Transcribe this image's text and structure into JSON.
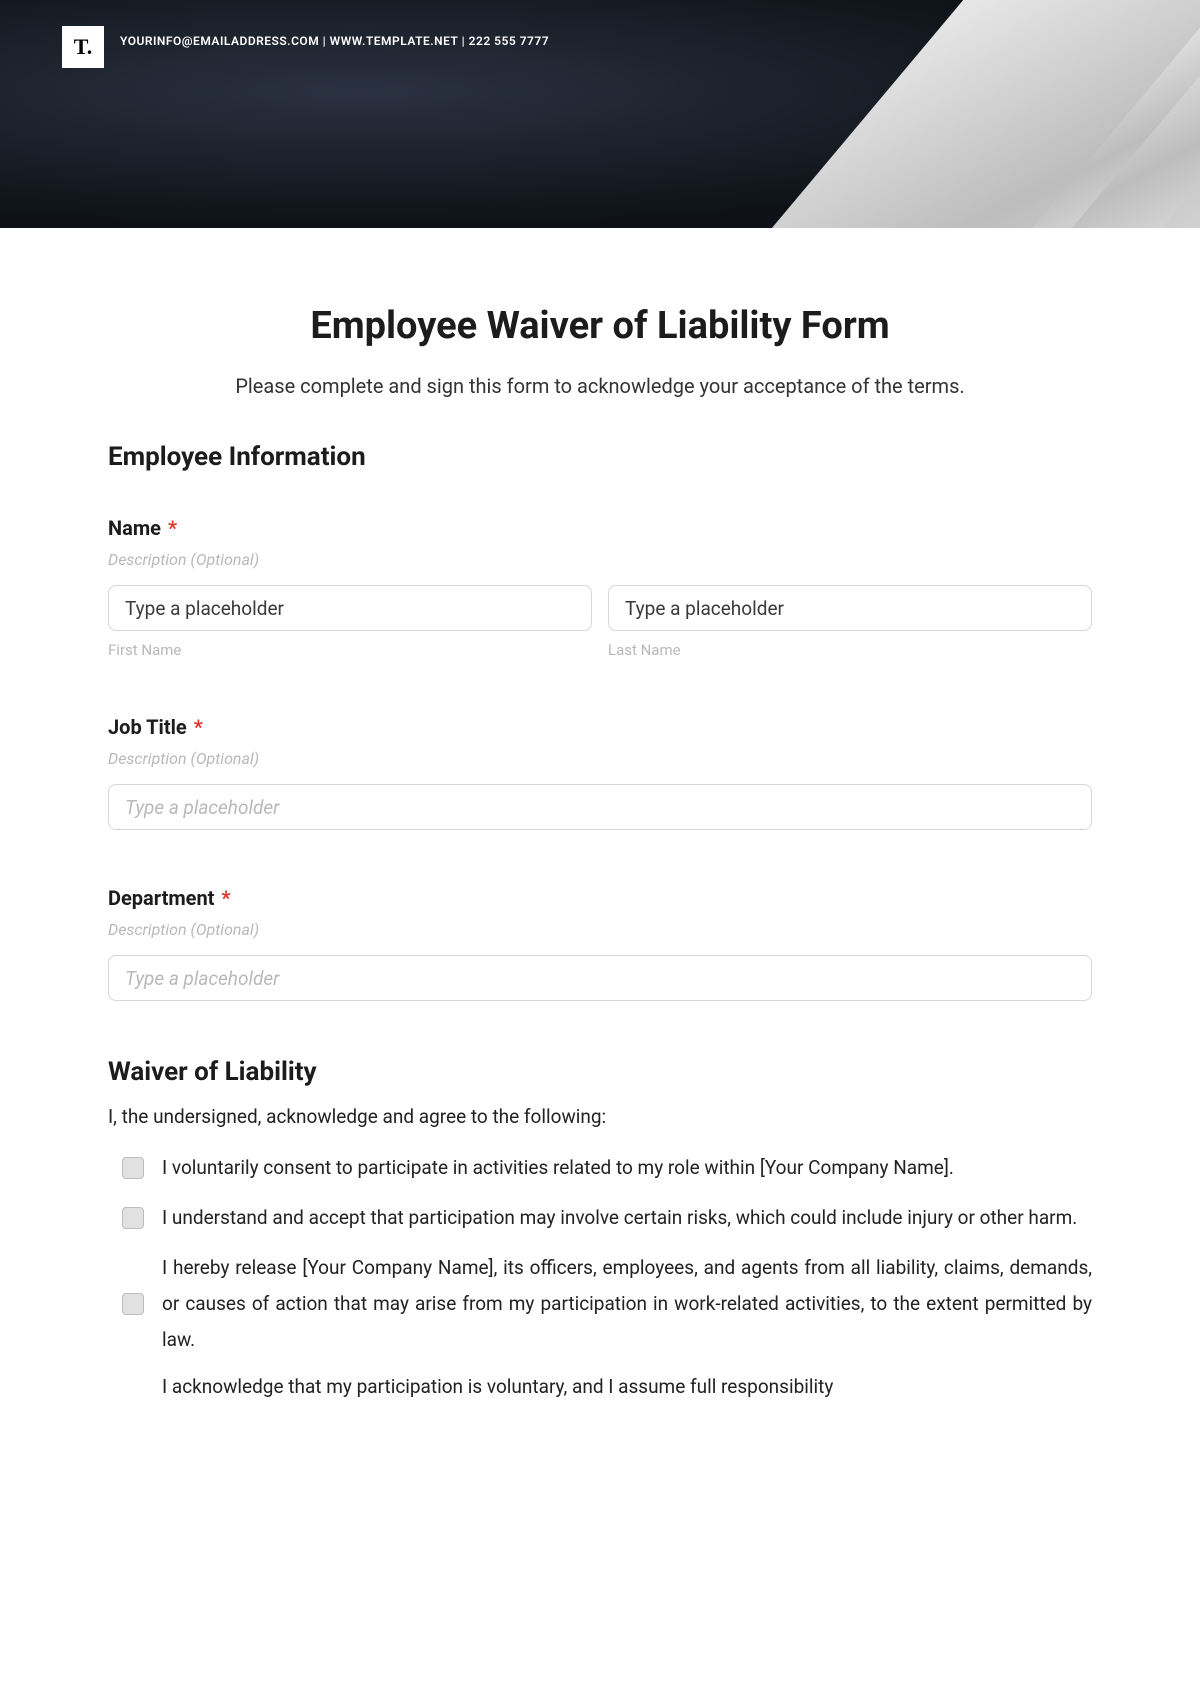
{
  "header": {
    "logo_text": "T.",
    "contact": "YOURINFO@EMAILADDRESS.COM  |  WWW.TEMPLATE.NET  |  222 555 7777"
  },
  "form": {
    "title": "Employee Waiver of Liability Form",
    "subtitle": "Please complete and sign this form to acknowledge your acceptance of the terms."
  },
  "section_employee": {
    "heading": "Employee Information",
    "name": {
      "label": "Name",
      "required_mark": "*",
      "description": "Description (Optional)",
      "first_placeholder": "Type a placeholder",
      "last_placeholder": "Type a placeholder",
      "first_sublabel": "First Name",
      "last_sublabel": "Last Name"
    },
    "job_title": {
      "label": "Job Title",
      "required_mark": "*",
      "description": "Description (Optional)",
      "placeholder": "Type a placeholder"
    },
    "department": {
      "label": "Department",
      "required_mark": "*",
      "description": "Description (Optional)",
      "placeholder": "Type a placeholder"
    }
  },
  "section_waiver": {
    "heading": "Waiver of Liability",
    "intro": "I, the undersigned, acknowledge and agree to the following:",
    "terms": [
      "I voluntarily consent to participate in activities related to my role within [Your Company Name].",
      "I understand and accept that participation may involve certain risks, which could include injury or other harm.",
      "I hereby release [Your Company Name], its officers, employees, and agents from all liability, claims, demands, or causes of action that may arise from my participation in work-related activities, to the extent permitted by law.",
      "I acknowledge that my participation is voluntary, and I assume full responsibility"
    ]
  }
}
